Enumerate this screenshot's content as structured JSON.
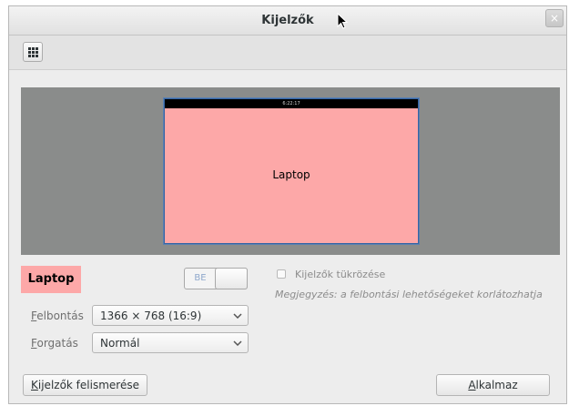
{
  "window": {
    "title": "Kijelzők",
    "close_icon": "×"
  },
  "toolbar": {
    "grid_icon": "grid-icon"
  },
  "preview": {
    "monitor_label": "Laptop",
    "monitor_clock": "6:22:17"
  },
  "display": {
    "name": "Laptop",
    "power_switch_label": "BE",
    "mirror_label": "Kijelzők tükrözése",
    "mirror_checked": false,
    "note": "Megjegyzés: a felbontási lehetőségeket korlátozhatja"
  },
  "resolution": {
    "label_mnemonic": "F",
    "label_rest": "elbontás",
    "value": "1366 × 768 (16:9)"
  },
  "rotation": {
    "label_mnemonic": "F",
    "label_rest": "orgatás",
    "value": "Normál"
  },
  "buttons": {
    "detect_mnemonic": "K",
    "detect_rest": "ijelzők felismerése",
    "apply_mnemonic": "A",
    "apply_rest": "lkalmaz"
  },
  "colors": {
    "monitor": "#fda8a8",
    "canvas": "#8a8c8b",
    "accent": "#3465a4"
  }
}
